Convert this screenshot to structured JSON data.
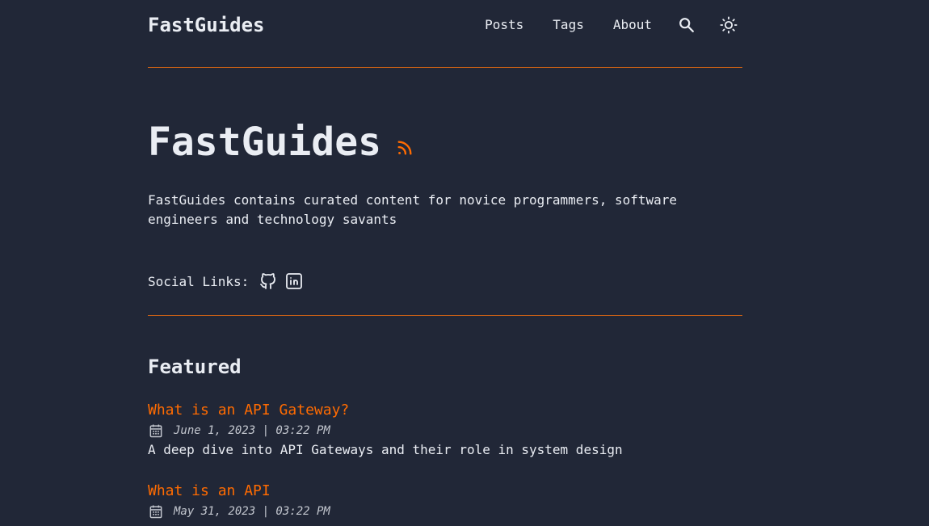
{
  "header": {
    "brand": "FastGuides",
    "nav": {
      "posts": "Posts",
      "tags": "Tags",
      "about": "About"
    }
  },
  "hero": {
    "title": "FastGuides",
    "description": "FastGuides contains curated content for novice programmers, software engineers and technology savants",
    "social_label": "Social Links:"
  },
  "featured": {
    "title": "Featured",
    "posts": [
      {
        "title": "What is an API Gateway?",
        "date": "June 1, 2023 | 03:22 PM",
        "description": "A deep dive into API Gateways and their role in system design"
      },
      {
        "title": "What is an API",
        "date": "May 31, 2023 | 03:22 PM",
        "description": ""
      }
    ]
  },
  "colors": {
    "background": "#212737",
    "text": "#eaedf3",
    "accent": "#ff6b01",
    "divider": "#c75f16"
  },
  "icons": [
    "search-icon",
    "sun-icon",
    "rss-icon",
    "github-icon",
    "linkedin-icon",
    "calendar-icon"
  ]
}
